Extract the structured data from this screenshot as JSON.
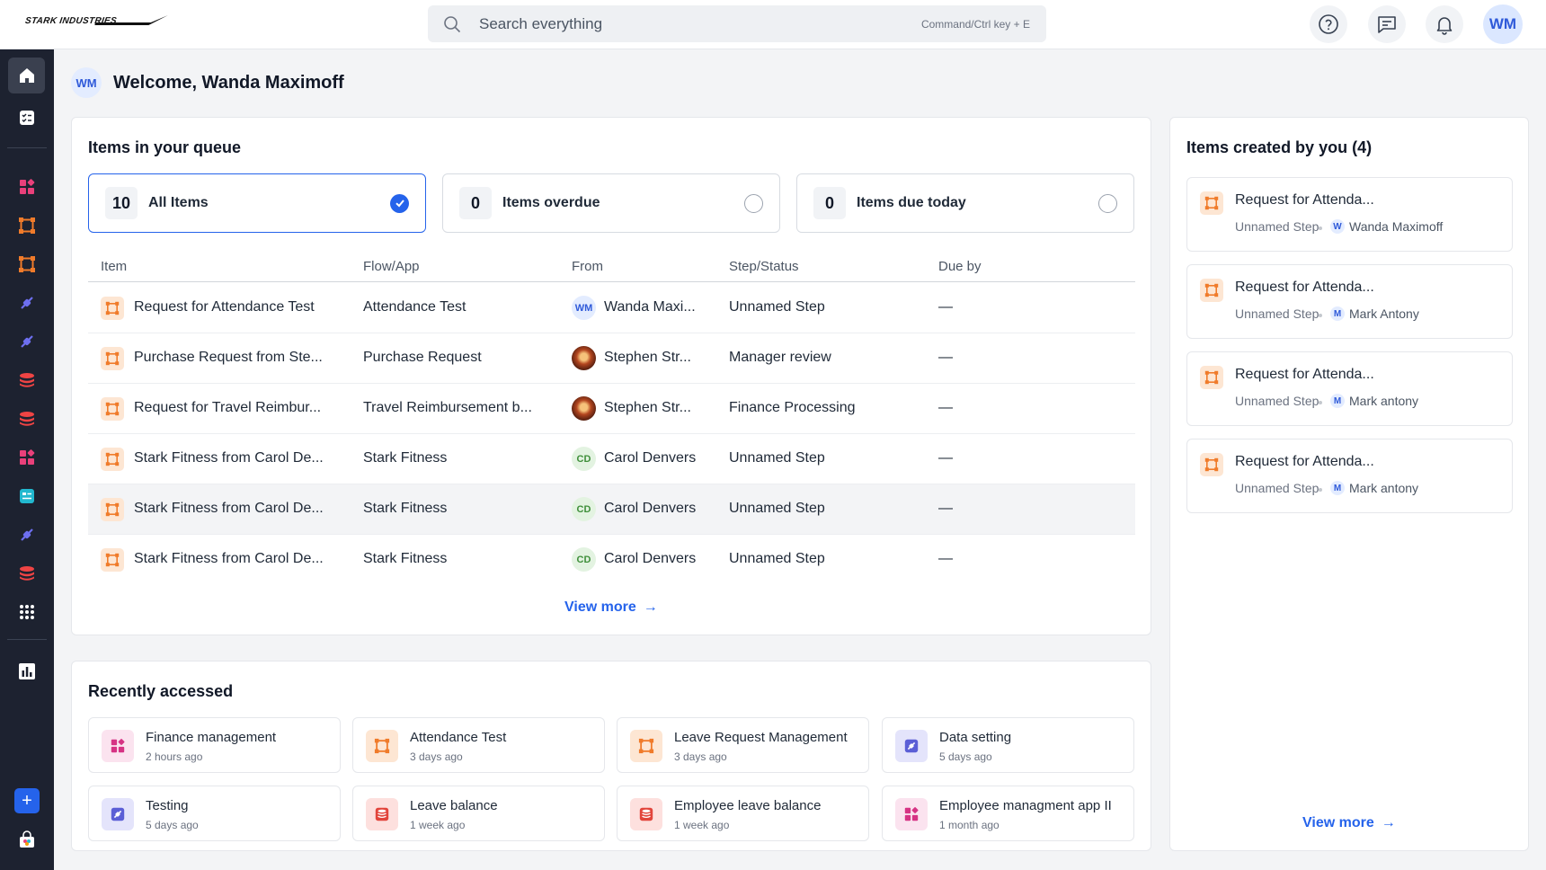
{
  "brand": {
    "logo_text": "STARK INDUSTRIES"
  },
  "search": {
    "placeholder": "Search everything",
    "shortcut": "Command/Ctrl key + E"
  },
  "user": {
    "initials": "WM"
  },
  "welcome": {
    "initials": "WM",
    "title": "Welcome, Wanda Maximoff"
  },
  "queue": {
    "title": "Items in your queue",
    "filters": [
      {
        "count": "10",
        "label": "All Items",
        "selected": true
      },
      {
        "count": "0",
        "label": "Items overdue",
        "selected": false
      },
      {
        "count": "0",
        "label": "Items due today",
        "selected": false
      }
    ],
    "columns": [
      "Item",
      "Flow/App",
      "From",
      "Step/Status",
      "Due by"
    ],
    "rows": [
      {
        "item": "Request for Attendance Test",
        "flow": "Attendance Test",
        "from_initials": "WM",
        "from": "Wanda Maxi...",
        "step": "Unnamed Step",
        "due": "—"
      },
      {
        "item": "Purchase Request from Ste...",
        "flow": "Purchase Request",
        "from_initials": "",
        "from": "Stephen Str...",
        "step": "Manager review",
        "due": "—"
      },
      {
        "item": "Request for Travel Reimbur...",
        "flow": "Travel Reimbursement b...",
        "from_initials": "",
        "from": "Stephen Str...",
        "step": "Finance Processing",
        "due": "—"
      },
      {
        "item": "Stark Fitness from Carol De...",
        "flow": "Stark Fitness",
        "from_initials": "CD",
        "from": "Carol Denvers",
        "step": "Unnamed Step",
        "due": "—"
      },
      {
        "item": "Stark Fitness from Carol De...",
        "flow": "Stark Fitness",
        "from_initials": "CD",
        "from": "Carol Denvers",
        "step": "Unnamed Step",
        "due": "—"
      },
      {
        "item": "Stark Fitness from Carol De...",
        "flow": "Stark Fitness",
        "from_initials": "CD",
        "from": "Carol Denvers",
        "step": "Unnamed Step",
        "due": "—"
      }
    ],
    "view_more": "View more"
  },
  "recent": {
    "title": "Recently accessed",
    "items": [
      {
        "name": "Finance management",
        "time": "2 hours ago",
        "icon": "apps-icon",
        "color": "#d63384"
      },
      {
        "name": "Attendance Test",
        "time": "3 days ago",
        "icon": "flow-icon",
        "color": "#f07b2a"
      },
      {
        "name": "Leave Request Management",
        "time": "3 days ago",
        "icon": "flow-icon",
        "color": "#f07b2a"
      },
      {
        "name": "Data setting",
        "time": "5 days ago",
        "icon": "plug-icon",
        "color": "#5b5fd6"
      },
      {
        "name": "Testing",
        "time": "5 days ago",
        "icon": "plug-icon",
        "color": "#5b5fd6"
      },
      {
        "name": "Leave balance",
        "time": "1 week ago",
        "icon": "database-icon",
        "color": "#e2453c"
      },
      {
        "name": "Employee leave balance",
        "time": "1 week ago",
        "icon": "database-icon",
        "color": "#e2453c"
      },
      {
        "name": "Employee managment app II",
        "time": "1 month ago",
        "icon": "apps-icon",
        "color": "#d63384"
      }
    ]
  },
  "created": {
    "title": "Items created by you (4)",
    "items": [
      {
        "name": "Request for Attenda...",
        "step": "Unnamed Step",
        "user_initial": "W",
        "user": "Wanda Maximoff"
      },
      {
        "name": "Request for Attenda...",
        "step": "Unnamed Step",
        "user_initial": "M",
        "user": "Mark Antony"
      },
      {
        "name": "Request for Attenda...",
        "step": "Unnamed Step",
        "user_initial": "M",
        "user": "Mark antony"
      },
      {
        "name": "Request for Attenda...",
        "step": "Unnamed Step",
        "user_initial": "M",
        "user": "Mark antony"
      }
    ],
    "view_more": "View more"
  },
  "sidebar": {
    "items": [
      {
        "icon": "home-icon",
        "active": true
      },
      {
        "icon": "tasks-icon"
      },
      {
        "icon": "apps-icon",
        "color": "#e9407a"
      },
      {
        "icon": "flow-icon",
        "color": "#f07b2a"
      },
      {
        "icon": "flow-icon",
        "color": "#f07b2a"
      },
      {
        "icon": "plug-icon",
        "color": "#6d6ff0"
      },
      {
        "icon": "plug-icon",
        "color": "#6d6ff0"
      },
      {
        "icon": "database-icon",
        "color": "#ef4444"
      },
      {
        "icon": "database-icon",
        "color": "#ef4444"
      },
      {
        "icon": "apps-icon",
        "color": "#e9407a"
      },
      {
        "icon": "board-icon",
        "color": "#22b8cf"
      },
      {
        "icon": "plug-icon",
        "color": "#6d6ff0"
      },
      {
        "icon": "database-icon",
        "color": "#ef4444"
      },
      {
        "icon": "grid-menu-icon"
      },
      {
        "icon": "chart-icon"
      }
    ]
  },
  "colors": {
    "accent": "#2563eb",
    "sidebar_bg": "#1d2230"
  }
}
